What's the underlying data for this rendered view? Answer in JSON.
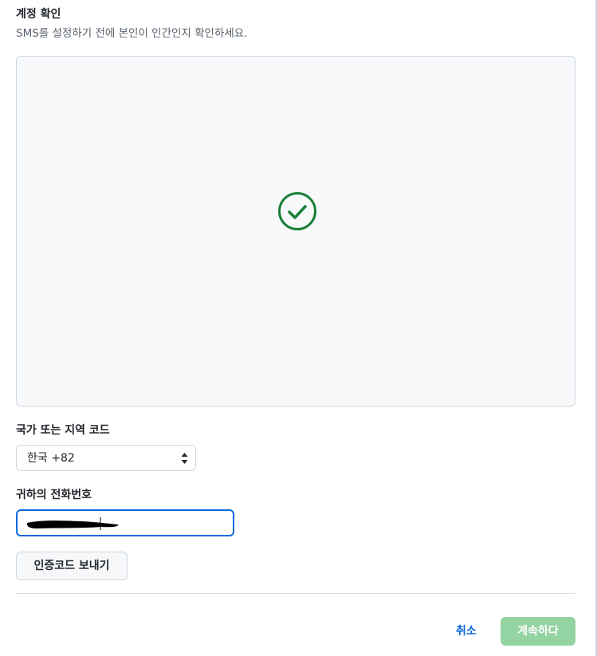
{
  "verify": {
    "title": "계정 확인",
    "subtitle": "SMS를 설정하기 전에 본인이 인간인지 확인하세요.",
    "status_icon": "check-circle-icon",
    "status_color": "#1a7f37"
  },
  "country": {
    "label": "국가 또는 지역 코드",
    "selected": "한국 +82"
  },
  "phone": {
    "label": "귀하의 전화번호",
    "value_redacted": true
  },
  "actions": {
    "send_code": "인증코드 보내기",
    "cancel": "취소",
    "continue": "계속하다"
  },
  "colors": {
    "link": "#0969da",
    "primary_disabled": "#94d3a2",
    "focus_border": "#0969da"
  }
}
